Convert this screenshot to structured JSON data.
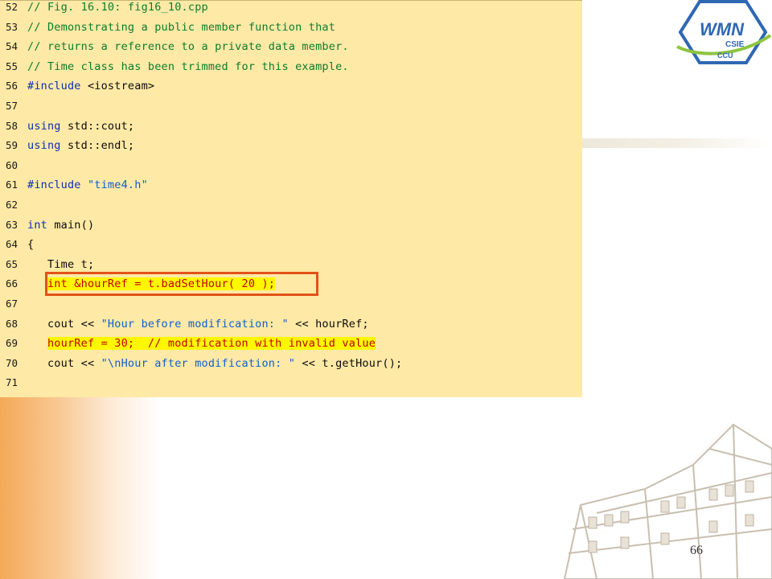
{
  "code": {
    "lines": [
      {
        "num": "52",
        "parts": [
          {
            "t": "// Fig. 16.10: fig16_10.cpp",
            "c": "comment"
          }
        ]
      },
      {
        "num": "53",
        "parts": [
          {
            "t": "// Demonstrating a public member function that",
            "c": "comment"
          }
        ]
      },
      {
        "num": "54",
        "parts": [
          {
            "t": "// returns a reference to a private data member.",
            "c": "comment"
          }
        ]
      },
      {
        "num": "55",
        "parts": [
          {
            "t": "// Time class has been trimmed for this example.",
            "c": "comment"
          }
        ]
      },
      {
        "num": "56",
        "parts": [
          {
            "t": "#include ",
            "c": "kw"
          },
          {
            "t": "<iostream>",
            "c": "plain"
          }
        ]
      },
      {
        "num": "57",
        "parts": []
      },
      {
        "num": "58",
        "parts": [
          {
            "t": "using ",
            "c": "kw"
          },
          {
            "t": "std::cout;",
            "c": "plain"
          }
        ]
      },
      {
        "num": "59",
        "parts": [
          {
            "t": "using ",
            "c": "kw"
          },
          {
            "t": "std::endl;",
            "c": "plain"
          }
        ]
      },
      {
        "num": "60",
        "parts": []
      },
      {
        "num": "61",
        "parts": [
          {
            "t": "#include ",
            "c": "kw"
          },
          {
            "t": "\"time4.h\"",
            "c": "str"
          }
        ]
      },
      {
        "num": "62",
        "parts": []
      },
      {
        "num": "63",
        "parts": [
          {
            "t": "int ",
            "c": "kw"
          },
          {
            "t": "main()",
            "c": "plain"
          }
        ]
      },
      {
        "num": "64",
        "parts": [
          {
            "t": "{",
            "c": "plain"
          }
        ]
      },
      {
        "num": "65",
        "parts": [
          {
            "t": "   Time t;",
            "c": "plain"
          }
        ]
      },
      {
        "num": "66",
        "parts": [
          {
            "t": "   ",
            "c": "plain"
          },
          {
            "t": "int &hourRef = t.badSetHour( 20 );",
            "c": "hl"
          }
        ]
      },
      {
        "num": "67",
        "parts": []
      },
      {
        "num": "68",
        "parts": [
          {
            "t": "   cout << ",
            "c": "plain"
          },
          {
            "t": "\"Hour before modification: \"",
            "c": "str"
          },
          {
            "t": " << hourRef;",
            "c": "plain"
          }
        ]
      },
      {
        "num": "69",
        "parts": [
          {
            "t": "   ",
            "c": "plain"
          },
          {
            "t": "hourRef = 30;  // modification with invalid value",
            "c": "hl"
          }
        ]
      },
      {
        "num": "70",
        "parts": [
          {
            "t": "   cout << ",
            "c": "plain"
          },
          {
            "t": "\"\\nHour after modification: \"",
            "c": "str"
          },
          {
            "t": " << t.getHour();",
            "c": "plain"
          }
        ]
      },
      {
        "num": "71",
        "parts": []
      }
    ]
  },
  "logo": {
    "text": "WMN",
    "sub1": "CSIE",
    "sub2": "CCU"
  },
  "page_number": "66",
  "colors": {
    "panel": "#ffe9a6",
    "comment": "#0a7d2c",
    "keyword": "#0b2fb5",
    "string": "#0d5fcf",
    "highlight_text": "#c20000",
    "highlight_bg": "#fff700",
    "box": "#e35218"
  }
}
